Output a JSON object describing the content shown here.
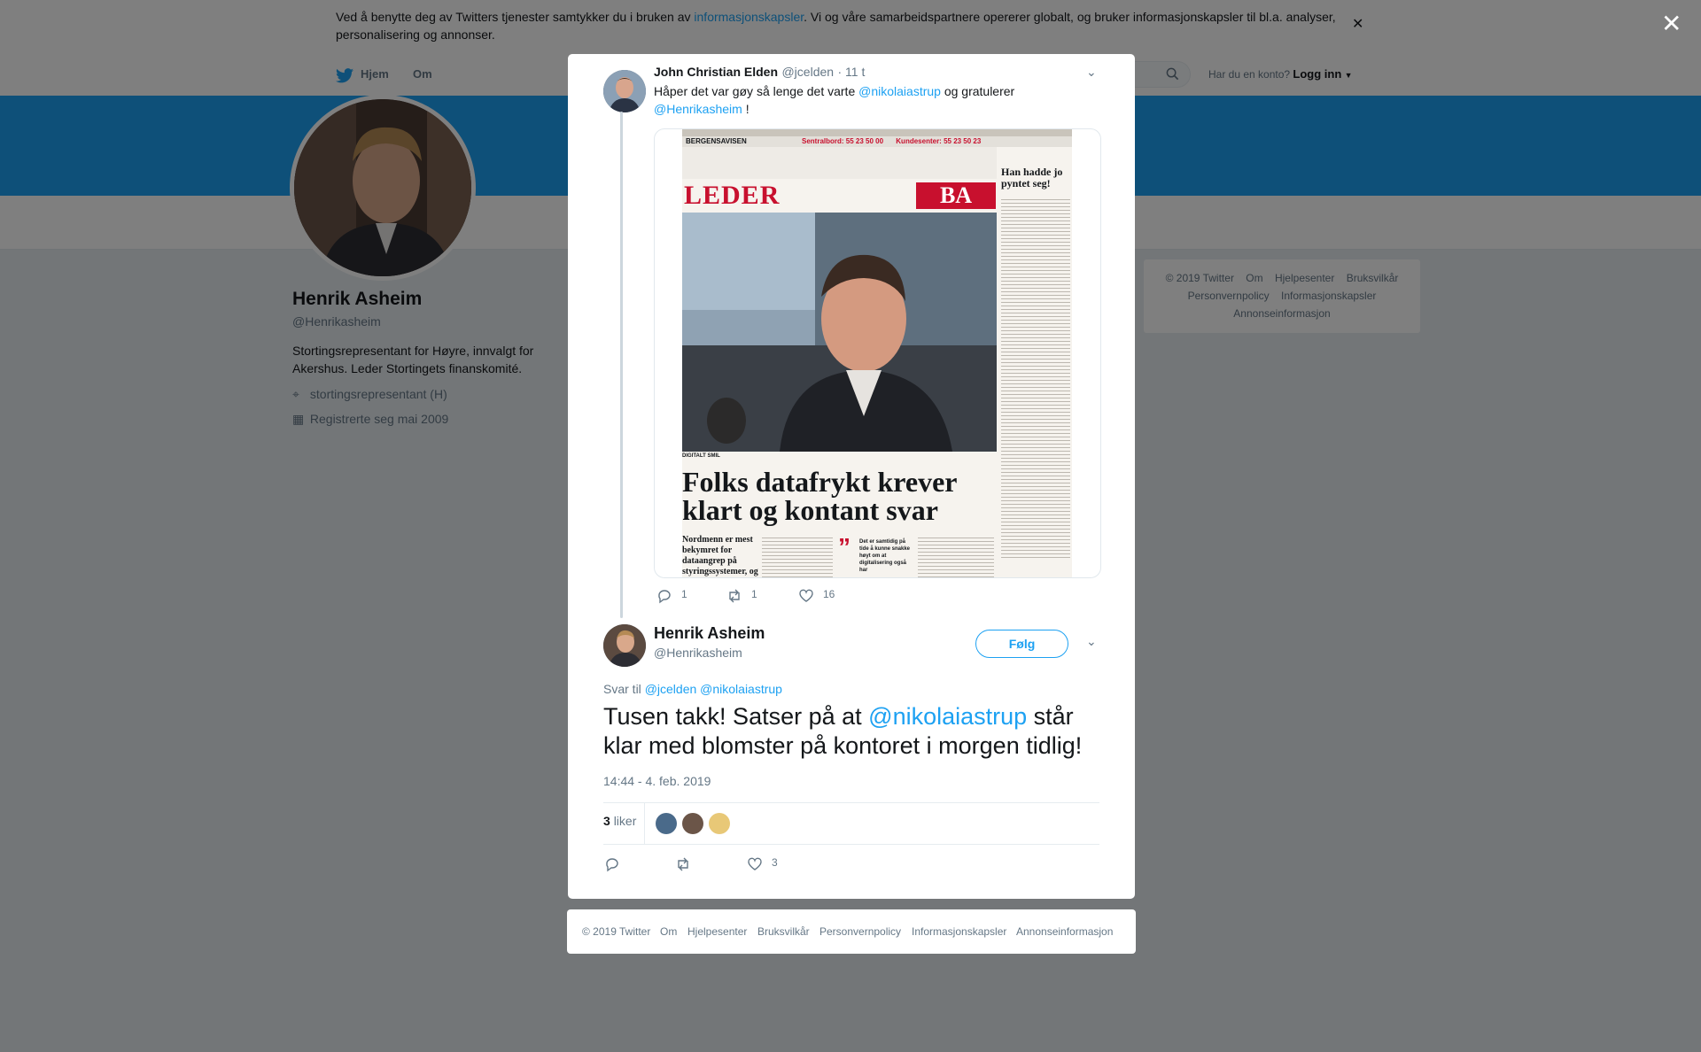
{
  "cookie_banner": {
    "text_before": "Ved å benytte deg av Twitters tjenester samtykker du i bruken av ",
    "link": "informasjonskapsler",
    "text_after": ". Vi og våre samarbeidspartnere opererer globalt, og bruker informasjonskapsler til bl.a. analyser, personalisering og annonser."
  },
  "topnav": {
    "home": "Hjem",
    "about": "Om",
    "have_account": "Har du en konto?",
    "login": "Logg inn"
  },
  "profile": {
    "name": "Henrik Asheim",
    "handle": "@Henrikasheim",
    "bio": "Stortingsrepresentant for Høyre, innvalgt for Akershus. Leder Stortingets finanskomité.",
    "location": "stortingsrepresentant (H)",
    "joined": "Registrerte seg mai 2009"
  },
  "side_footer": {
    "row1": [
      "© 2019 Twitter",
      "Om",
      "Hjelpesenter",
      "Bruksvilkår"
    ],
    "row2": [
      "Personvernpolicy",
      "Informasjonskapsler"
    ],
    "row3": [
      "Annonseinformasjon"
    ]
  },
  "parent_tweet": {
    "name": "John Christian Elden",
    "handle": "@jcelden",
    "time": "· 11 t",
    "text_1": "Håper det var gøy så lenge det varte ",
    "mention_1": "@nikolaiastrup",
    "text_2": " og gratulerer ",
    "mention_2": "@Henrikasheim",
    "text_3": " !",
    "replies": "1",
    "retweets": "1",
    "likes": "16",
    "media": {
      "masthead": "BERGENSAVISEN",
      "sentralbord": "Sentralbord: 55 23 50 00",
      "kundesenter": "Kundesenter: 55 23 50 23",
      "section": "LEDER",
      "logo": "BA",
      "side_headline": "Han hadde jo pyntet seg!",
      "headline": "Folks datafrykt krever klart og kontant svar",
      "caption": "DIGITALT SMIL",
      "lead": "Nordmenn er mest bekymret for dataangrep på styringssystemer, og vi er mer bekymret for en",
      "quote": "Det er samtidig på tide å kunne snakke høyt om at digitalisering også har"
    }
  },
  "main_tweet": {
    "name": "Henrik Asheim",
    "handle": "@Henrikasheim",
    "follow": "Følg",
    "reply_to_label": "Svar til ",
    "reply_to_1": "@jcelden",
    "reply_to_2": "@nikolaiastrup",
    "text_1": "Tusen takk! Satser på at ",
    "mention": "@nikolaiastrup",
    "text_2": " står klar med blomster på kontoret i morgen tidlig!",
    "timestamp": "14:44 - 4. feb. 2019",
    "likes_count": "3",
    "likes_label": "liker",
    "action_likes": "3"
  },
  "modal_footer": [
    "© 2019 Twitter",
    "Om",
    "Hjelpesenter",
    "Bruksvilkår",
    "Personvernpolicy",
    "Informasjonskapsler",
    "Annonseinformasjon"
  ],
  "colors": {
    "twitter_blue": "#1da1f2",
    "text": "#14171a",
    "muted": "#657786",
    "overlay": "rgba(0,0,0,0.5)"
  }
}
